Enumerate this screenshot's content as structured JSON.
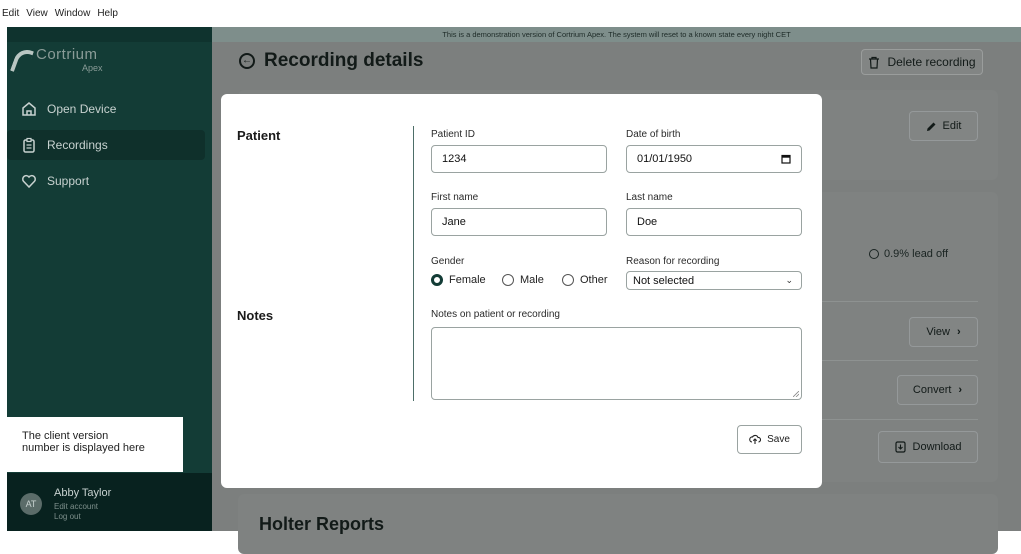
{
  "menubar": {
    "items": [
      "Edit",
      "View",
      "Window",
      "Help"
    ]
  },
  "banner": {
    "text": "This is a demonstration version of Cortrium Apex. The system will reset to a known state every night CET"
  },
  "logo": {
    "name": "Cortrium",
    "sub": "Apex"
  },
  "sidebar": {
    "items": [
      {
        "label": "Open Device",
        "icon": "home-icon"
      },
      {
        "label": "Recordings",
        "icon": "clipboard-icon"
      },
      {
        "label": "Support",
        "icon": "heart-icon"
      }
    ],
    "active": "Recordings"
  },
  "tooltip": {
    "line1": "The client version",
    "line2": "number is displayed here"
  },
  "user": {
    "initials": "AT",
    "name": "Abby Taylor",
    "edit": "Edit account",
    "logout": "Log out"
  },
  "page": {
    "title": "Recording details",
    "delete_label": "Delete recording",
    "edit_label": "Edit",
    "lead_off": "0.9% lead off",
    "view_label": "View",
    "convert_label": "Convert",
    "download_label": "Download",
    "holter_title": "Holter Reports"
  },
  "modal": {
    "patient_section": "Patient",
    "notes_section": "Notes",
    "patient_id": {
      "label": "Patient ID",
      "value": "1234"
    },
    "dob": {
      "label": "Date of birth",
      "value": "01/01/1950"
    },
    "first_name": {
      "label": "First name",
      "value": "Jane"
    },
    "last_name": {
      "label": "Last name",
      "value": "Doe"
    },
    "gender": {
      "label": "Gender",
      "options": [
        "Female",
        "Male",
        "Other"
      ],
      "selected": "Female"
    },
    "reason": {
      "label": "Reason for recording",
      "value": "Not selected"
    },
    "notes": {
      "label": "Notes on patient or recording",
      "value": ""
    },
    "save_label": "Save"
  },
  "colors": {
    "sidebar": "#133c36",
    "accent": "#133c36",
    "overlay": "#7c7f7e"
  }
}
